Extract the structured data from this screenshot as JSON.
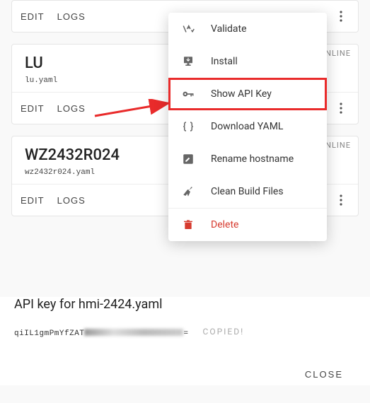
{
  "labels": {
    "edit": "EDIT",
    "logs": "LOGS",
    "status_online": "NLINE"
  },
  "cards": {
    "lu": {
      "title": "LU",
      "filename": "lu.yaml"
    },
    "wz": {
      "title": "WZ2432R024",
      "filename": "wz2432r024.yaml"
    }
  },
  "menu": {
    "validate": "Validate",
    "install": "Install",
    "show_api_key": "Show API Key",
    "download_yaml": "Download YAML",
    "rename_hostname": "Rename hostname",
    "clean_build": "Clean Build Files",
    "delete": "Delete"
  },
  "dialog": {
    "title": "API key for hmi-2424.yaml",
    "key_prefix": "qiIL1gmPmYfZAT",
    "key_suffix": "=",
    "copied": "COPIED!",
    "close": "CLOSE"
  }
}
